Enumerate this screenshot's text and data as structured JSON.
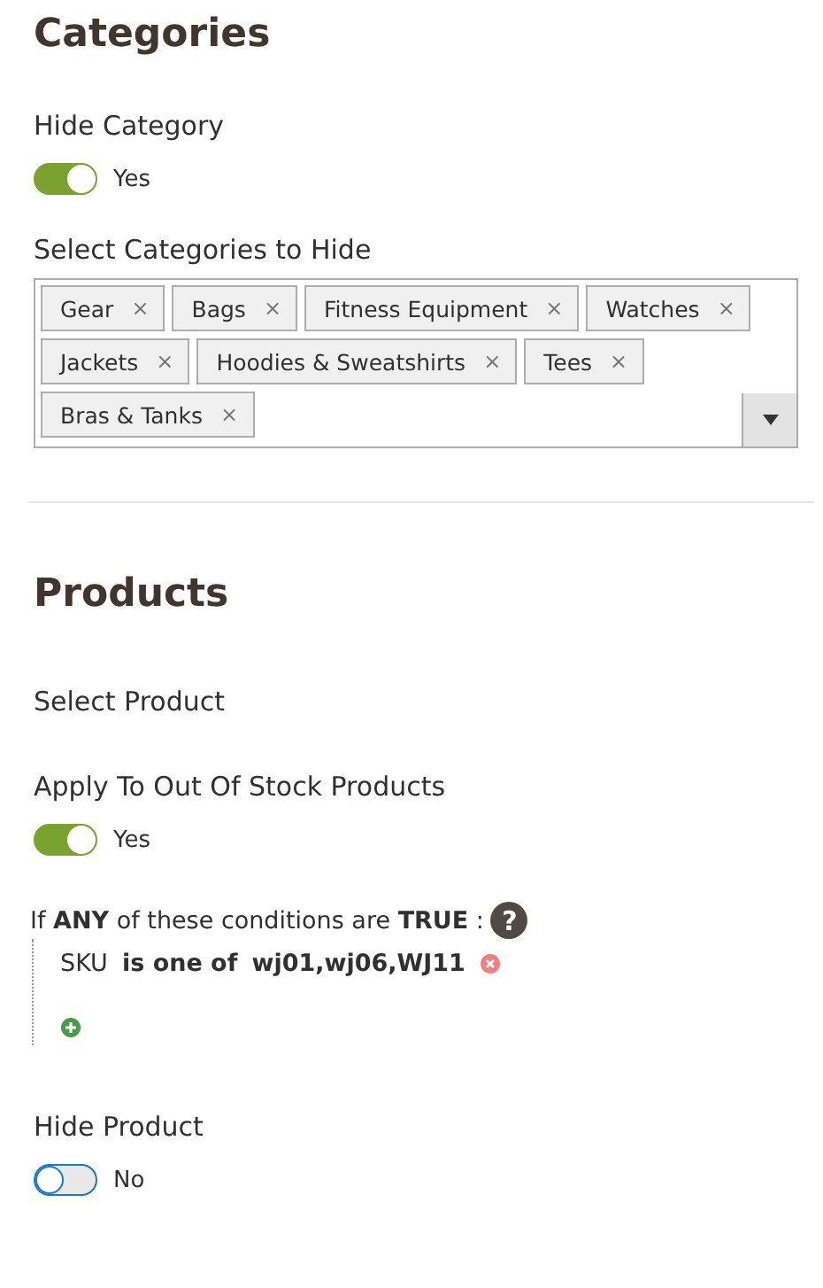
{
  "categories": {
    "title": "Categories",
    "hide_category": {
      "label": "Hide Category",
      "on": true,
      "state_text": "Yes"
    },
    "select": {
      "label": "Select Categories to Hide",
      "tags": [
        "Gear",
        "Bags",
        "Fitness Equipment",
        "Watches",
        "Jackets",
        "Hoodies & Sweatshirts",
        "Tees",
        "Bras & Tanks"
      ],
      "remove_glyph": "×"
    }
  },
  "products": {
    "title": "Products",
    "select_product": {
      "label": "Select Product"
    },
    "out_of_stock": {
      "label": "Apply To Out Of Stock Products",
      "on": true,
      "state_text": "Yes"
    },
    "conditions": {
      "heading": "If **ANY** of these conditions are **TRUE** :",
      "help": "?",
      "rules": [
        {
          "attribute": "SKU",
          "operator": "is one of",
          "value": "wj01,wj06,WJ11"
        }
      ]
    },
    "hide_product": {
      "label": "Hide Product",
      "on": false,
      "state_text": "No"
    }
  }
}
